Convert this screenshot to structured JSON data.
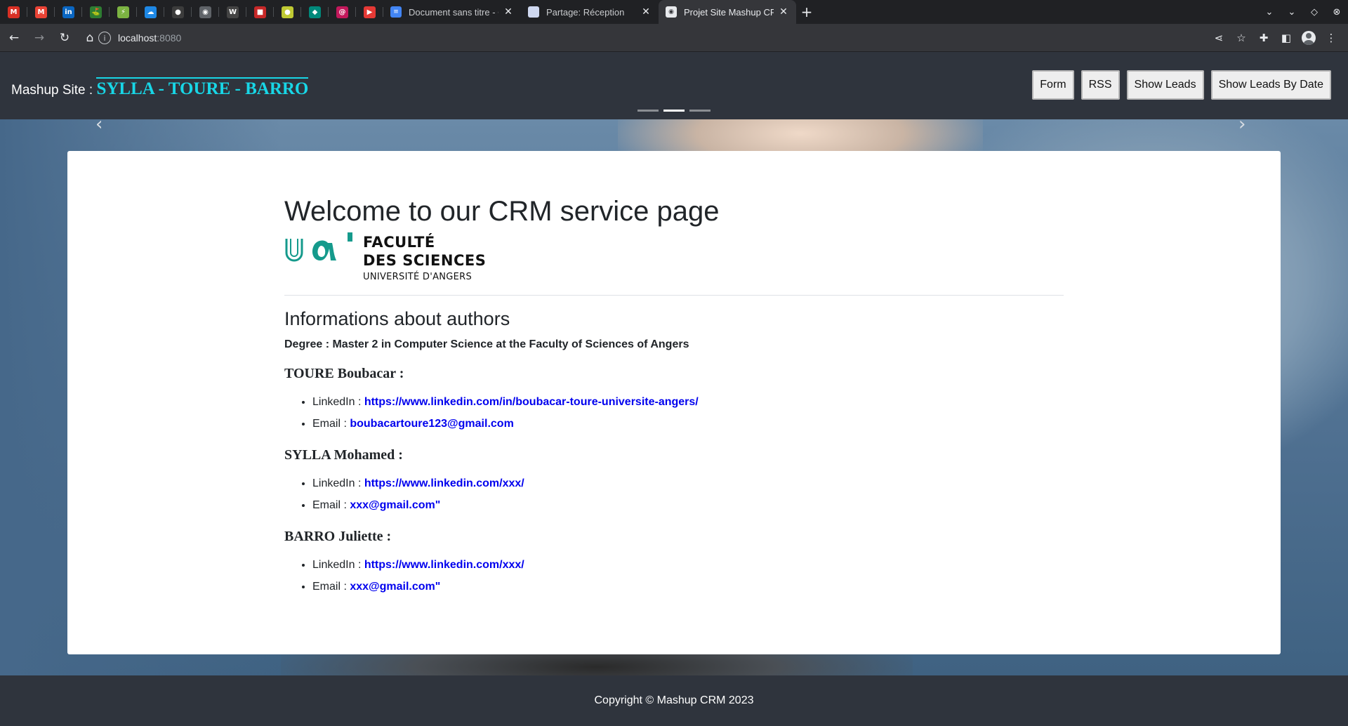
{
  "browser": {
    "pinned_tabs": [
      {
        "icon": "gmail-icon",
        "glyph": "M",
        "color": "#d93025"
      },
      {
        "icon": "gmail-icon",
        "glyph": "M",
        "color": "#ea4335"
      },
      {
        "icon": "linkedin-icon",
        "glyph": "in",
        "color": "#0a66c2"
      },
      {
        "icon": "green-app-icon",
        "glyph": "⛳",
        "color": "#2e7d32"
      },
      {
        "icon": "leaf-icon",
        "glyph": "⚡",
        "color": "#7cb342"
      },
      {
        "icon": "cloud-icon",
        "glyph": "☁",
        "color": "#1e88e5"
      },
      {
        "icon": "github-icon",
        "glyph": "●",
        "color": "#3c3c3c"
      },
      {
        "icon": "globe-icon",
        "glyph": "◉",
        "color": "#5f6368"
      },
      {
        "icon": "wikipedia-icon",
        "glyph": "W",
        "color": "#444"
      },
      {
        "icon": "red-square-icon",
        "glyph": "■",
        "color": "#c62828"
      },
      {
        "icon": "lemon-icon",
        "glyph": "●",
        "color": "#c0ca33"
      },
      {
        "icon": "teal-app-icon",
        "glyph": "◆",
        "color": "#00897b"
      },
      {
        "icon": "debian-icon",
        "glyph": "@",
        "color": "#c2185b"
      },
      {
        "icon": "youtube-icon",
        "glyph": "▶",
        "color": "#e53935"
      }
    ],
    "tabs": [
      {
        "title": "Document sans titre - Google",
        "icon": "google-docs-icon",
        "close": "✕",
        "active": false
      },
      {
        "title": "Partage: Réception",
        "icon": "mail-page-icon",
        "close": "✕",
        "active": false
      },
      {
        "title": "Projet Site Mashup CRM",
        "icon": "globe-icon",
        "close": "✕",
        "active": true
      }
    ],
    "new_tab": "+",
    "url_host": "localhost",
    "url_port": ":8080"
  },
  "site": {
    "brand_prefix": "Mashup Site : ",
    "brand_authors": "SYLLA - TOURE - BARRO",
    "nav": [
      "Form",
      "RSS",
      "Show Leads",
      "Show Leads By Date"
    ],
    "carousel_active_index": 1
  },
  "main": {
    "welcome": "Welcome to our CRM service page",
    "logo": {
      "line1": "FACULTÉ",
      "line2": "DES SCIENCES",
      "line3": "UNIVERSITÉ D'ANGERS",
      "brand_color": "#159a8c"
    },
    "authors_title": "Informations about authors",
    "degree": "Degree : Master 2 in Computer Science at the Faculty of Sciences of Angers",
    "people": [
      {
        "name": "TOURE Boubacar :",
        "linkedin_label": "LinkedIn : ",
        "linkedin": "https://www.linkedin.com/in/boubacar-toure-universite-angers/",
        "email_label": "Email : ",
        "email": "boubacartoure123@gmail.com"
      },
      {
        "name": "SYLLA Mohamed :",
        "linkedin_label": "LinkedIn : ",
        "linkedin": "https://www.linkedin.com/xxx/",
        "email_label": "Email : ",
        "email": "xxx@gmail.com\""
      },
      {
        "name": "BARRO Juliette :",
        "linkedin_label": "LinkedIn : ",
        "linkedin": "https://www.linkedin.com/xxx/",
        "email_label": "Email : ",
        "email": "xxx@gmail.com\""
      }
    ]
  },
  "footer": {
    "copyright": "Copyright © Mashup CRM 2023"
  }
}
